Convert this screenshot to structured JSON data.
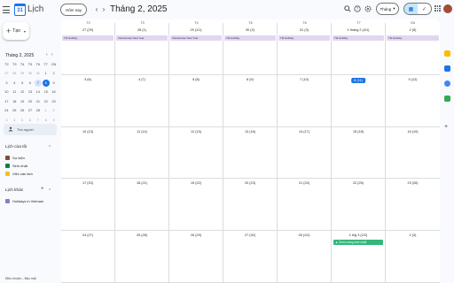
{
  "header": {
    "app_title": "Lịch",
    "logo_text": "31",
    "today_button": "Hôm nay",
    "prev_icon": "‹",
    "next_icon": "›",
    "month_title": "Tháng 2, 2025",
    "view_select": "Tháng",
    "icons": [
      "search-icon",
      "help-icon",
      "settings-icon",
      "calendar-view-icon",
      "tasks-view-icon",
      "apps-icon",
      "avatar"
    ]
  },
  "sidebar": {
    "create_label": "Tạo",
    "mini_calendar": {
      "title": "Tháng 2, 2025",
      "weekday_labels": [
        "T2",
        "T3",
        "T4",
        "T5",
        "T6",
        "T7",
        "CN"
      ],
      "days": [
        "27",
        "28",
        "29",
        "30",
        "31",
        "1",
        "2",
        "3",
        "4",
        "5",
        "6",
        "7",
        "8",
        "9",
        "10",
        "11",
        "12",
        "13",
        "14",
        "15",
        "16",
        "17",
        "18",
        "19",
        "20",
        "21",
        "22",
        "23",
        "24",
        "25",
        "26",
        "27",
        "28",
        "1",
        "2",
        "3",
        "4",
        "5",
        "6",
        "7",
        "8",
        "9"
      ],
      "selected_day_index": 12,
      "highlight_day_index": 11
    },
    "search_people": "Tìm người",
    "my_calendars": {
      "title": "Lịch của tôi",
      "items": [
        {
          "label": "Sự kiện",
          "color": "#7a4f3a"
        },
        {
          "label": "Sinh nhật",
          "color": "#0b8043"
        },
        {
          "label": "Việc cần làm",
          "color": "#f6bf26"
        }
      ]
    },
    "other_calendars": {
      "title": "Lịch khác",
      "items": [
        {
          "label": "Holidays in Vietnam",
          "color": "#8e7cc3"
        }
      ]
    },
    "footer": "Điều khoản – Bảo mật"
  },
  "calendar": {
    "weekday_header": [
      "T2",
      "T3",
      "T4",
      "T5",
      "T6",
      "T7",
      "CN"
    ],
    "weeks": [
      {
        "days": [
          "27 (29)",
          "28 (1)",
          "29 (1/1)",
          "30 (2)",
          "31 (3)",
          "1 tháng 2 (4/1)",
          "2 (5)"
        ],
        "allday": [
          "Tết Holiday",
          "Vietnamese New Year",
          "Vietnamese New Year",
          "Tết Holiday",
          "Tết Holiday",
          "Tết Holiday",
          "Tết Holiday"
        ]
      },
      {
        "days": [
          "3 (6)",
          "4 (7)",
          "5 (8)",
          "6 (9)",
          "7 (10)",
          "8 (11)",
          "9 (12)"
        ]
      },
      {
        "days": [
          "10 (13)",
          "11 (14)",
          "12 (15)",
          "13 (16)",
          "14 (17)",
          "15 (18)",
          "16 (19)"
        ]
      },
      {
        "days": [
          "17 (20)",
          "18 (21)",
          "19 (22)",
          "20 (23)",
          "21 (24)",
          "22 (25)",
          "23 (26)"
        ]
      },
      {
        "days": [
          "24 (27)",
          "25 (28)",
          "26 (29)",
          "27 (30)",
          "28 (1/2)",
          "1 thg 3 (2/2)",
          "2 (3)"
        ]
      }
    ],
    "today_label": "8 (11)",
    "event": {
      "label": "Chúc mừng sinh nhật!",
      "color": "#33b679"
    }
  },
  "side_panel": {
    "add_label": "+"
  }
}
